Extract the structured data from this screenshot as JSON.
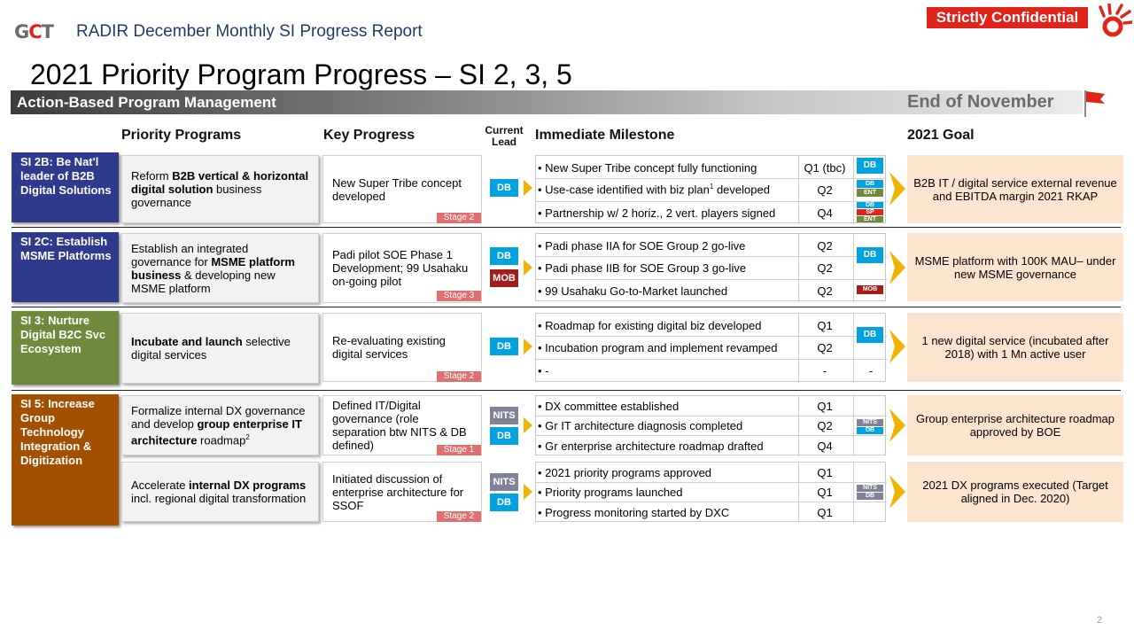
{
  "header": {
    "report_title": "RADIR December Monthly SI Progress Report",
    "confidential": "Strictly Confidential",
    "page_title": "2021 Priority Program Progress – SI 2, 3, 5",
    "banner_label": "Action-Based Program Management",
    "banner_date": "End of November",
    "page_number": "2"
  },
  "columns": {
    "priority_programs": "Priority Programs",
    "key_progress": "Key Progress",
    "current_lead": "Current Lead",
    "immediate_milestone": "Immediate Milestone",
    "goal_2021": "2021 Goal"
  },
  "colors": {
    "navy": "#2e3b8c",
    "olive": "#6f8a3c",
    "brown": "#a24f00",
    "db_blue": "#00a3e0",
    "mob_red": "#a31d1d",
    "nits_gray": "#7f8298",
    "goal_peach": "#fde4cf",
    "stage_pink": "#e07070"
  },
  "si_labels": {
    "si2b": "SI 2B: Be Nat'l leader of B2B Digital Solutions",
    "si2c": "SI 2C: Establish MSME Platforms",
    "si3": "SI 3: Nurture Digital B2C Svc Ecosystem",
    "si5": "SI 5: Increase Group Technology Integration & Digitization"
  },
  "programs": {
    "p1_a": "Reform ",
    "p1_b": "B2B vertical & horizontal digital solution",
    "p1_c": " business governance",
    "p2_a": "Establish an integrated governance for ",
    "p2_b": "MSME platform business",
    "p2_c": " & developing new MSME platform",
    "p3_a": "Incubate and launch",
    "p3_b": " selective digital services",
    "p4_a": "Formalize internal DX governance and develop ",
    "p4_b": "group enterprise IT architecture",
    "p4_c": " roadmap",
    "p4_sup": "2",
    "p5_a": "Accelerate ",
    "p5_b": "internal DX programs",
    "p5_c": " incl. regional digital transformation"
  },
  "progress": {
    "k1": "New Super Tribe concept developed",
    "k1_stage": "Stage 2",
    "k2": "Padi pilot SOE Phase 1 Development; 99 Usahaku on-going pilot",
    "k2_stage": "Stage 3",
    "k3": "Re-evaluating existing digital services",
    "k3_stage": "Stage 2",
    "k4": "Defined IT/Digital governance (role separation btw NITS & DB defined)",
    "k4_stage": "Stage 1",
    "k5": "Initiated discussion of enterprise architecture for SSOF",
    "k5_stage": "Stage 2"
  },
  "leads": {
    "db": "DB",
    "mob": "MOB",
    "nits": "NITS",
    "db_small": "DB",
    "ent": "ENT",
    "sp": "SP",
    "nits_small": "NITS"
  },
  "milestones": {
    "m1": [
      {
        "text": "• New Super Tribe concept fully functioning",
        "q": "Q1 (tbc)"
      },
      {
        "text": "• Use-case identified with biz plan",
        "sup": "1",
        "text2": " developed",
        "q": "Q2"
      },
      {
        "text": "• Partnership w/ 2 horiz., 2 vert. players signed",
        "q": "Q4"
      }
    ],
    "m2": [
      {
        "text": "• Padi phase IIA for SOE Group 2 go-live",
        "q": "Q2"
      },
      {
        "text": "• Padi phase IIB for SOE Group 3 go-live",
        "q": "Q2"
      },
      {
        "text": "• 99  Usahaku Go-to-Market launched",
        "q": "Q2"
      }
    ],
    "m3": [
      {
        "text": "• Roadmap for existing digital biz developed",
        "q": "Q1"
      },
      {
        "text": "• Incubation program and implement revamped",
        "q": "Q2"
      },
      {
        "text": "• -",
        "q": "-",
        "lead": "-"
      }
    ],
    "m4": [
      {
        "text": "• DX committee established",
        "q": "Q1"
      },
      {
        "text": "• Gr IT architecture diagnosis completed",
        "q": "Q2"
      },
      {
        "text": "• Gr enterprise architecture roadmap drafted",
        "q": "Q4"
      }
    ],
    "m5": [
      {
        "text": "• 2021 priority programs approved",
        "q": "Q1"
      },
      {
        "text": "• Priority programs launched",
        "q": "Q1"
      },
      {
        "text": "• Progress monitoring started by DXC",
        "q": "Q1"
      }
    ]
  },
  "goals": {
    "g1": "B2B IT / digital service external revenue and EBITDA margin 2021 RKAP",
    "g2": "MSME platform with 100K MAU– under new MSME governance",
    "g3": "1  new digital service (incubated after 2018) with 1 Mn active user",
    "g4": "Group enterprise architecture roadmap approved by BOE",
    "g5": "2021 DX programs executed (Target aligned in Dec. 2020)"
  },
  "icons": [
    "flag-icon",
    "chevron-right-icon",
    "brand-mark-icon"
  ]
}
